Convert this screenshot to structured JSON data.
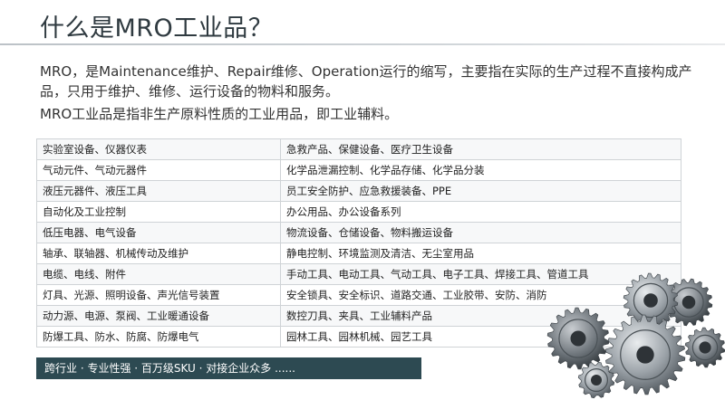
{
  "title": "什么是MRO工业品？",
  "description": {
    "paragraph1": "MRO，是Maintenance维护、Repair维修、Operation运行的缩写，主要指在实际的生产过程不直接构成产品，只用于维护、维修、运行设备的物料和服务。",
    "paragraph2": "MRO工业品是指非生产原料性质的工业用品，即工业辅料。"
  },
  "table": {
    "rows": [
      [
        "实验室设备、仪器仪表",
        "急救产品、保健设备、医疗卫生设备"
      ],
      [
        "气动元件、气动元器件",
        "化学品泄漏控制、化学品存储、化学品分装"
      ],
      [
        "液压元器件、液压工具",
        "员工安全防护、应急救援装备、PPE"
      ],
      [
        "自动化及工业控制",
        "办公用品、办公设备系列"
      ],
      [
        "低压电器、电气设备",
        "物流设备、仓储设备、物料搬运设备"
      ],
      [
        "轴承、联轴器、机械传动及维护",
        "静电控制、环境监测及清洁、无尘室用品"
      ],
      [
        "电缆、电线、附件",
        "手动工具、电动工具、气动工具、电子工具、焊接工具、管道工具"
      ],
      [
        "灯具、光源、照明设备、声光信号装置",
        "安全锁具、安全标识、道路交通、工业胶带、安防、消防"
      ],
      [
        "动力源、电源、泵阀、工业暖通设备",
        "数控刀具、夹具、工业辅料产品"
      ],
      [
        "防爆工具、防水、防腐、防爆电气",
        "园林工具、园林机械、园艺工具"
      ]
    ]
  },
  "banner": "跨行业 · 专业性强 · 百万级SKU · 对接企业众多 ......",
  "colors": {
    "banner_bg": "#2d4a52",
    "title": "#2f3a40",
    "border": "#cfd3d6"
  },
  "icons": {
    "decoration": "gears-icon"
  }
}
